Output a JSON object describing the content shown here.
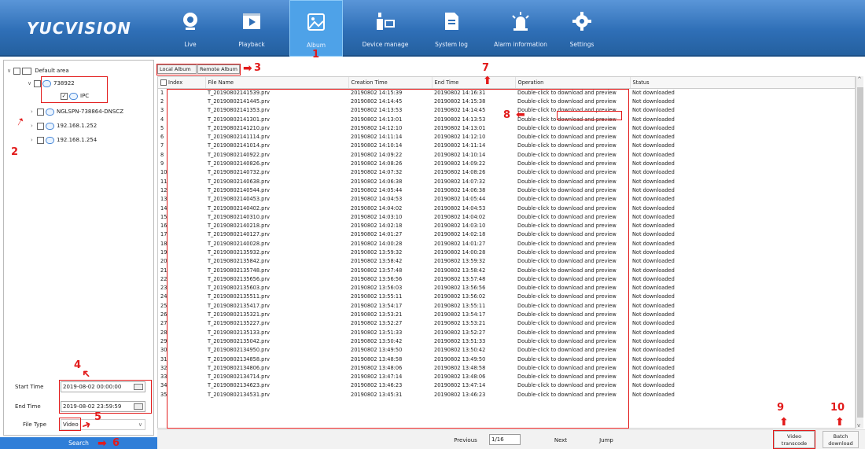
{
  "header": {
    "logo": "YUCVISION",
    "nav": [
      {
        "label": "Live",
        "icon": "webcam-icon"
      },
      {
        "label": "Playback",
        "icon": "film-icon"
      },
      {
        "label": "Album",
        "icon": "picture-icon"
      },
      {
        "label": "Device manage",
        "icon": "device-icon"
      },
      {
        "label": "System log",
        "icon": "document-icon"
      },
      {
        "label": "Alarm information",
        "icon": "alarm-icon"
      },
      {
        "label": "Settings",
        "icon": "gear-icon"
      }
    ]
  },
  "tree": {
    "root": "Default area",
    "items": [
      "738922",
      "IPC",
      "NGLSPN-738864-DNSCZ",
      "192.168.1.252",
      "192.168.1.254"
    ]
  },
  "filters": {
    "start_label": "Start Time",
    "start_value": "2019-08-02 00:00:00",
    "end_label": "End Time",
    "end_value": "2019-08-02 23:59:59",
    "type_label": "File Type",
    "type_value": "Video",
    "search_label": "Search"
  },
  "tabs": {
    "local": "Local Album",
    "remote": "Remote Album"
  },
  "table": {
    "columns": [
      "Index",
      "File Name",
      "Creation Time",
      "End Time",
      "Operation",
      "Status"
    ],
    "operation_text": "Double-click to download and preview",
    "status_text": "Not downloaded",
    "rows": [
      [
        "1",
        "T_20190802141539.prv",
        "20190802 14:15:39",
        "20190802 14:16:31"
      ],
      [
        "2",
        "T_20190802141445.prv",
        "20190802 14:14:45",
        "20190802 14:15:38"
      ],
      [
        "3",
        "T_20190802141353.prv",
        "20190802 14:13:53",
        "20190802 14:14:45"
      ],
      [
        "4",
        "T_20190802141301.prv",
        "20190802 14:13:01",
        "20190802 14:13:53"
      ],
      [
        "5",
        "T_20190802141210.prv",
        "20190802 14:12:10",
        "20190802 14:13:01"
      ],
      [
        "6",
        "T_20190802141114.prv",
        "20190802 14:11:14",
        "20190802 14:12:10"
      ],
      [
        "7",
        "T_20190802141014.prv",
        "20190802 14:10:14",
        "20190802 14:11:14"
      ],
      [
        "8",
        "T_20190802140922.prv",
        "20190802 14:09:22",
        "20190802 14:10:14"
      ],
      [
        "9",
        "T_20190802140826.prv",
        "20190802 14:08:26",
        "20190802 14:09:22"
      ],
      [
        "10",
        "T_20190802140732.prv",
        "20190802 14:07:32",
        "20190802 14:08:26"
      ],
      [
        "11",
        "T_20190802140638.prv",
        "20190802 14:06:38",
        "20190802 14:07:32"
      ],
      [
        "12",
        "T_20190802140544.prv",
        "20190802 14:05:44",
        "20190802 14:06:38"
      ],
      [
        "13",
        "T_20190802140453.prv",
        "20190802 14:04:53",
        "20190802 14:05:44"
      ],
      [
        "14",
        "T_20190802140402.prv",
        "20190802 14:04:02",
        "20190802 14:04:53"
      ],
      [
        "15",
        "T_20190802140310.prv",
        "20190802 14:03:10",
        "20190802 14:04:02"
      ],
      [
        "16",
        "T_20190802140218.prv",
        "20190802 14:02:18",
        "20190802 14:03:10"
      ],
      [
        "17",
        "T_20190802140127.prv",
        "20190802 14:01:27",
        "20190802 14:02:18"
      ],
      [
        "18",
        "T_20190802140028.prv",
        "20190802 14:00:28",
        "20190802 14:01:27"
      ],
      [
        "19",
        "T_20190802135932.prv",
        "20190802 13:59:32",
        "20190802 14:00:28"
      ],
      [
        "20",
        "T_20190802135842.prv",
        "20190802 13:58:42",
        "20190802 13:59:32"
      ],
      [
        "21",
        "T_20190802135748.prv",
        "20190802 13:57:48",
        "20190802 13:58:42"
      ],
      [
        "22",
        "T_20190802135656.prv",
        "20190802 13:56:56",
        "20190802 13:57:48"
      ],
      [
        "23",
        "T_20190802135603.prv",
        "20190802 13:56:03",
        "20190802 13:56:56"
      ],
      [
        "24",
        "T_20190802135511.prv",
        "20190802 13:55:11",
        "20190802 13:56:02"
      ],
      [
        "25",
        "T_20190802135417.prv",
        "20190802 13:54:17",
        "20190802 13:55:11"
      ],
      [
        "26",
        "T_20190802135321.prv",
        "20190802 13:53:21",
        "20190802 13:54:17"
      ],
      [
        "27",
        "T_20190802135227.prv",
        "20190802 13:52:27",
        "20190802 13:53:21"
      ],
      [
        "28",
        "T_20190802135133.prv",
        "20190802 13:51:33",
        "20190802 13:52:27"
      ],
      [
        "29",
        "T_20190802135042.prv",
        "20190802 13:50:42",
        "20190802 13:51:33"
      ],
      [
        "30",
        "T_20190802134950.prv",
        "20190802 13:49:50",
        "20190802 13:50:42"
      ],
      [
        "31",
        "T_20190802134858.prv",
        "20190802 13:48:58",
        "20190802 13:49:50"
      ],
      [
        "32",
        "T_20190802134806.prv",
        "20190802 13:48:06",
        "20190802 13:48:58"
      ],
      [
        "33",
        "T_20190802134714.prv",
        "20190802 13:47:14",
        "20190802 13:48:06"
      ],
      [
        "34",
        "T_20190802134623.prv",
        "20190802 13:46:23",
        "20190802 13:47:14"
      ],
      [
        "35",
        "T_20190802134531.prv",
        "20190802 13:45:31",
        "20190802 13:46:23"
      ]
    ]
  },
  "pager": {
    "previous": "Previous",
    "page": "1/16",
    "next": "Next",
    "jump": "Jump"
  },
  "bottom_buttons": {
    "transcode": "Video transcode",
    "batch": "Batch download"
  },
  "annotations": [
    "1",
    "2",
    "3",
    "4",
    "5",
    "6",
    "7",
    "8",
    "9",
    "10"
  ],
  "colors": {
    "accent": "#2f7ed8",
    "annotation": "#e21b1b"
  }
}
